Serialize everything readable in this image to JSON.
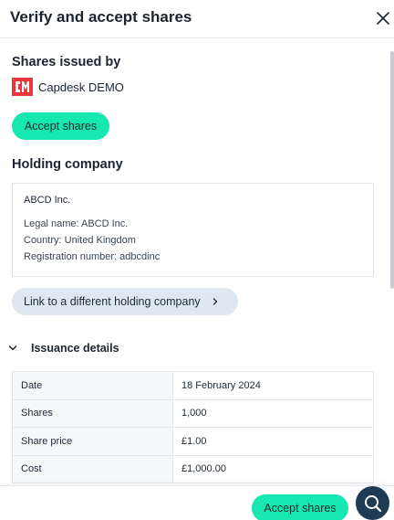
{
  "dialog": {
    "title": "Verify and accept shares",
    "close_icon": "close-icon"
  },
  "issuer": {
    "section_title": "Shares issued by",
    "logo_icon": "capdesk-logo",
    "name": "Capdesk DEMO",
    "accept_label": "Accept shares"
  },
  "holding": {
    "section_title": "Holding company",
    "company_name": "ABCD Inc.",
    "legal_name_label": "Legal name:",
    "legal_name_value": "ABCD Inc.",
    "country_label": "Country:",
    "country_value": "United Kingdom",
    "registration_label": "Registration number:",
    "registration_value": "adbcdinc",
    "link_label": "Link to a different holding company"
  },
  "issuance": {
    "title": "Issuance details",
    "expanded": true,
    "rows": [
      {
        "label": "Date",
        "value": "18 February 2024"
      },
      {
        "label": "Shares",
        "value": "1,000"
      },
      {
        "label": "Share price",
        "value": "£1.00"
      },
      {
        "label": "Cost",
        "value": "£1,000.00"
      }
    ]
  },
  "footer": {
    "accept_label": "Accept shares",
    "search_icon": "search-icon"
  },
  "colors": {
    "accent": "#17e7b0",
    "link_bg": "#dde8f2",
    "fab_bg": "#1e3a54",
    "logo_red": "#e8383d"
  }
}
